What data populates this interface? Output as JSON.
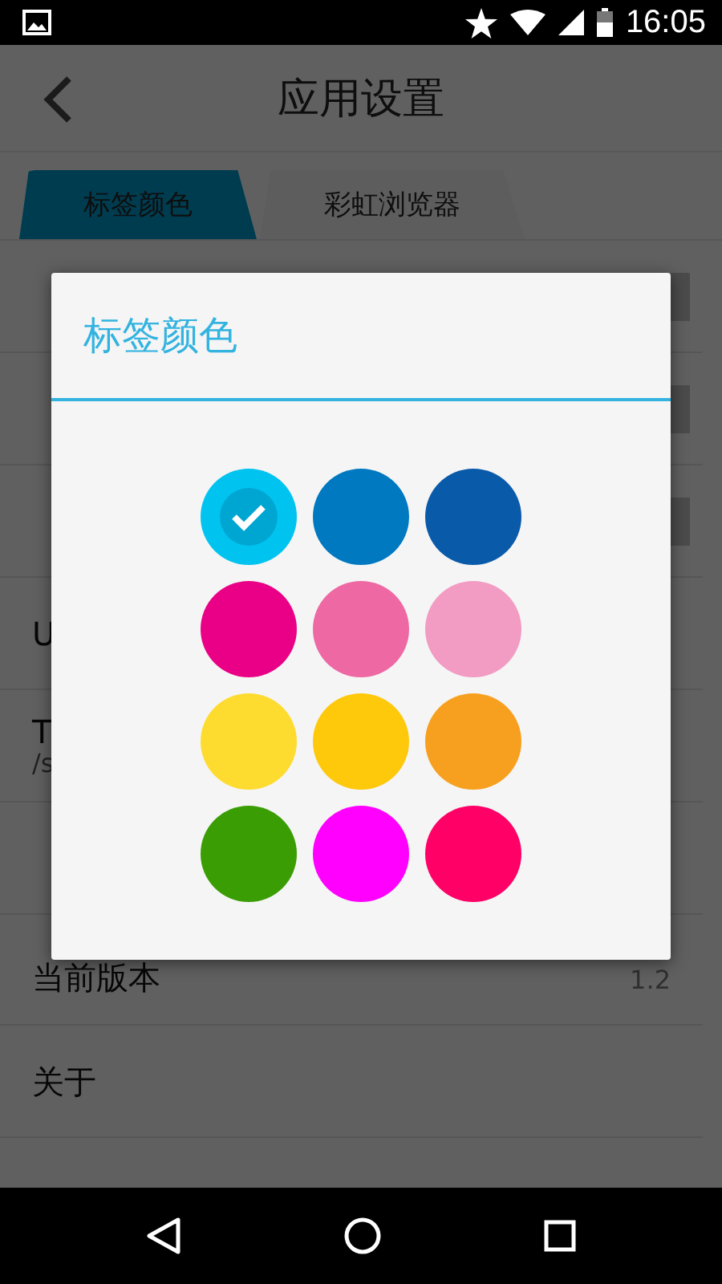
{
  "status_bar": {
    "time": "16:05"
  },
  "app_bar": {
    "title": "应用设置"
  },
  "tabs": [
    {
      "label": "标签颜色",
      "selected": true
    },
    {
      "label": "彩虹浏览器",
      "selected": false
    }
  ],
  "settings": [
    {
      "kind": "toggle",
      "checked": false
    },
    {
      "kind": "toggle",
      "checked": false
    },
    {
      "kind": "toggle",
      "checked": false
    },
    {
      "kind": "text",
      "title": "U"
    },
    {
      "kind": "text",
      "title": "T",
      "subtitle": "/s"
    },
    {
      "kind": "text"
    },
    {
      "kind": "text",
      "title": "当前版本",
      "value": "1.2"
    },
    {
      "kind": "text",
      "title": "关于"
    }
  ],
  "dialog": {
    "title": "标签颜色",
    "colors": [
      {
        "color": "#00c3f0",
        "selected": true
      },
      {
        "color": "#0079c1",
        "selected": false
      },
      {
        "color": "#0a5aaa",
        "selected": false
      },
      {
        "color": "#ea0086",
        "selected": false
      },
      {
        "color": "#ee68a3",
        "selected": false
      },
      {
        "color": "#f29bc3",
        "selected": false
      },
      {
        "color": "#fedb2f",
        "selected": false
      },
      {
        "color": "#fec80b",
        "selected": false
      },
      {
        "color": "#f7a01f",
        "selected": false
      },
      {
        "color": "#3a9d04",
        "selected": false
      },
      {
        "color": "#ff00ff",
        "selected": false
      },
      {
        "color": "#ff0066",
        "selected": false
      }
    ]
  }
}
